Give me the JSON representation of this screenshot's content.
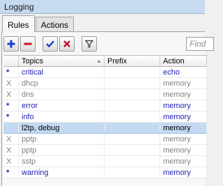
{
  "window": {
    "title": "Logging"
  },
  "tabs": [
    {
      "label": "Rules",
      "active": true
    },
    {
      "label": "Actions",
      "active": false
    }
  ],
  "toolbar": {
    "buttons": [
      "add-icon",
      "remove-icon",
      "enable-check-icon",
      "disable-x-icon",
      "filter-icon"
    ],
    "find_placeholder": "Find"
  },
  "columns": [
    "",
    "Topics",
    "Prefix",
    "Action"
  ],
  "rows": [
    {
      "flag": "*",
      "topics": "critical",
      "prefix": "",
      "action": "echo",
      "state": "enabled"
    },
    {
      "flag": "X",
      "topics": "dhcp",
      "prefix": "",
      "action": "memory",
      "state": "disabled"
    },
    {
      "flag": "X",
      "topics": "dns",
      "prefix": "",
      "action": "memory",
      "state": "disabled"
    },
    {
      "flag": "*",
      "topics": "error",
      "prefix": "",
      "action": "memory",
      "state": "enabled"
    },
    {
      "flag": "*",
      "topics": "info",
      "prefix": "",
      "action": "memory",
      "state": "enabled"
    },
    {
      "flag": "",
      "topics": "l2tp, debug",
      "prefix": "",
      "action": "memory",
      "state": "selected"
    },
    {
      "flag": "X",
      "topics": "pptp",
      "prefix": "",
      "action": "memory",
      "state": "disabled"
    },
    {
      "flag": "X",
      "topics": "pptp",
      "prefix": "",
      "action": "memory",
      "state": "disabled"
    },
    {
      "flag": "X",
      "topics": "sstp",
      "prefix": "",
      "action": "memory",
      "state": "disabled"
    },
    {
      "flag": "*",
      "topics": "warning",
      "prefix": "",
      "action": "memory",
      "state": "enabled"
    }
  ],
  "colors": {
    "accent": "#1c1cb4",
    "selected_row": "#c4daf2",
    "disabled_text": "#808080"
  }
}
